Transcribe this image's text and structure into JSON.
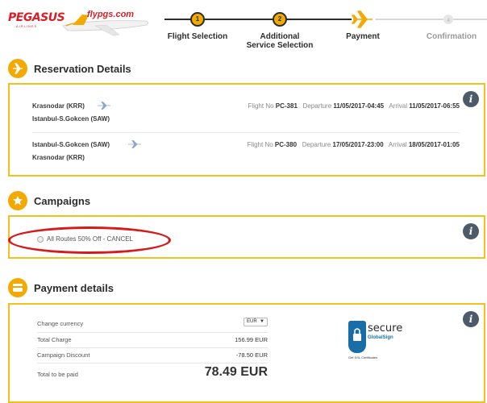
{
  "header": {
    "logo_brand": "PEGASUS",
    "logo_sub": "AIRLINES",
    "logo_domain": "flypgs.com",
    "steps": [
      {
        "number": "1",
        "label": "Flight Selection"
      },
      {
        "number": "2",
        "label": "Additional Service Selection"
      },
      {
        "number": "",
        "label": "Payment"
      },
      {
        "number": "4",
        "label": "Confirmation"
      }
    ]
  },
  "reservation": {
    "title": "Reservation Details",
    "flights": [
      {
        "origin": "Krasnodar (KRR)",
        "destination": "Istanbul-S.Gokcen (SAW)",
        "flight_no_label": "Flight No",
        "flight_no": "PC-381",
        "departure_label": "Departure",
        "departure": "11/05/2017-04:45",
        "arrival_label": "Arrival",
        "arrival": "11/05/2017-06:55"
      },
      {
        "origin": "Istanbul-S.Gokcen (SAW)",
        "destination": "Krasnodar (KRR)",
        "flight_no_label": "Flight No",
        "flight_no": "PC-380",
        "departure_label": "Departure",
        "departure": "17/05/2017-23:00",
        "arrival_label": "Arrival",
        "arrival": "18/05/2017-01:05"
      }
    ]
  },
  "campaigns": {
    "title": "Campaigns",
    "option_label": "All Routes 50% Off - CANCEL"
  },
  "payment": {
    "title": "Payment details",
    "change_currency_label": "Change currency",
    "currency": "EUR",
    "total_charge_label": "Total Charge",
    "total_charge": "156.99 EUR",
    "campaign_discount_label": "Campaign Discount",
    "campaign_discount": "-78.50 EUR",
    "total_to_pay_label": "Total to be paid",
    "total_to_pay": "78.49 EUR",
    "ssl": {
      "secure": "secure",
      "brand": "GlobalSign",
      "cert": "Get SSL Certificates"
    }
  },
  "info_icon": "i",
  "colors": {
    "accent": "#f2a900",
    "panel_border": "#f2c11b",
    "brand_red": "#d81e27",
    "highlight_red": "#d61a1a",
    "info_bg": "#4d5a6a"
  }
}
